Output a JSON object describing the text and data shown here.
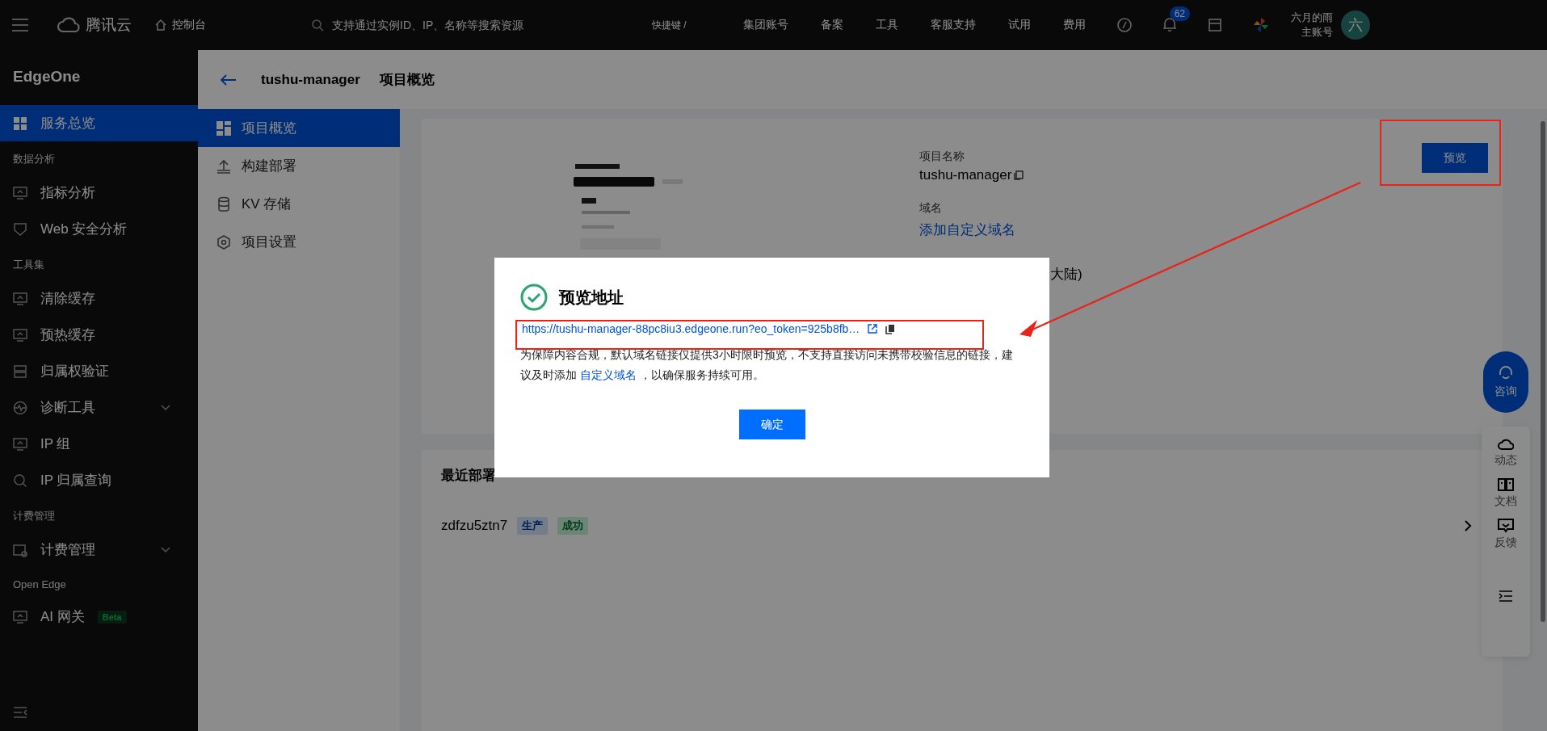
{
  "topbar": {
    "brand": "腾讯云",
    "console": "控制台",
    "search": {
      "placeholder": "支持通过实例ID、IP、名称等搜索资源"
    },
    "shortcut": "快捷键 /",
    "links": [
      "集团账号",
      "备案",
      "工具",
      "客服支持",
      "试用",
      "费用"
    ],
    "notifications": "62",
    "user": {
      "name": "六月的雨",
      "role": "主账号",
      "avatar": "六"
    }
  },
  "sidebar": {
    "product": "EdgeOne",
    "items": [
      {
        "kind": "item",
        "label": "服务总览",
        "selected": true
      },
      {
        "kind": "heading",
        "label": "数据分析"
      },
      {
        "kind": "item",
        "label": "指标分析",
        "selected": false
      },
      {
        "kind": "item",
        "label": "Web 安全分析",
        "selected": false
      },
      {
        "kind": "heading",
        "label": "工具集"
      },
      {
        "kind": "item",
        "label": "清除缓存",
        "selected": false
      },
      {
        "kind": "item",
        "label": "预热缓存",
        "selected": false
      },
      {
        "kind": "item",
        "label": "归属权验证",
        "selected": false
      },
      {
        "kind": "item",
        "label": "诊断工具",
        "selected": false,
        "expanded": false
      },
      {
        "kind": "item",
        "label": "IP 组",
        "selected": false
      },
      {
        "kind": "item",
        "label": "IP 归属查询",
        "selected": false
      },
      {
        "kind": "heading",
        "label": "计费管理"
      },
      {
        "kind": "item",
        "label": "计费管理",
        "selected": false,
        "expanded": false
      },
      {
        "kind": "heading",
        "label": "Open Edge"
      },
      {
        "kind": "item",
        "label": "AI 网关",
        "selected": false,
        "badge": "Beta"
      }
    ]
  },
  "header": {
    "project": "tushu-manager",
    "title": "项目概览"
  },
  "project_nav": [
    {
      "label": "项目概览",
      "selected": true
    },
    {
      "label": "构建部署",
      "selected": false
    },
    {
      "label": "KV 存储",
      "selected": false
    },
    {
      "label": "项目设置",
      "selected": false
    }
  ],
  "overview": {
    "preview_button": "预览",
    "name_label": "项目名称",
    "name": "tushu-manager",
    "domain_label": "域名",
    "domain_link": "添加自定义域名",
    "partial_text": "大陆)"
  },
  "recent": {
    "title": "最近部署",
    "deployments": [
      {
        "id": "zdfzu5ztn7",
        "tags": [
          {
            "label": "生产",
            "kind": "environment"
          },
          {
            "label": "成功",
            "kind": "status"
          }
        ]
      }
    ]
  },
  "float_panel": {
    "consult": "咨询",
    "tools": [
      "动态",
      "文档",
      "反馈"
    ]
  },
  "dialog": {
    "title": "预览地址",
    "url": "https://tushu-manager-88pc8iu3.edgeone.run?eo_token=925b8fb…",
    "notice_before": "为保障内容合规，默认域名链接仅提供3小时限时预览，不支持直接访问未携带校验信息的链接，建议及时添加 ",
    "notice_link": "自定义域名",
    "notice_after": " ，以确保服务持续可用。",
    "confirm": "确定"
  }
}
